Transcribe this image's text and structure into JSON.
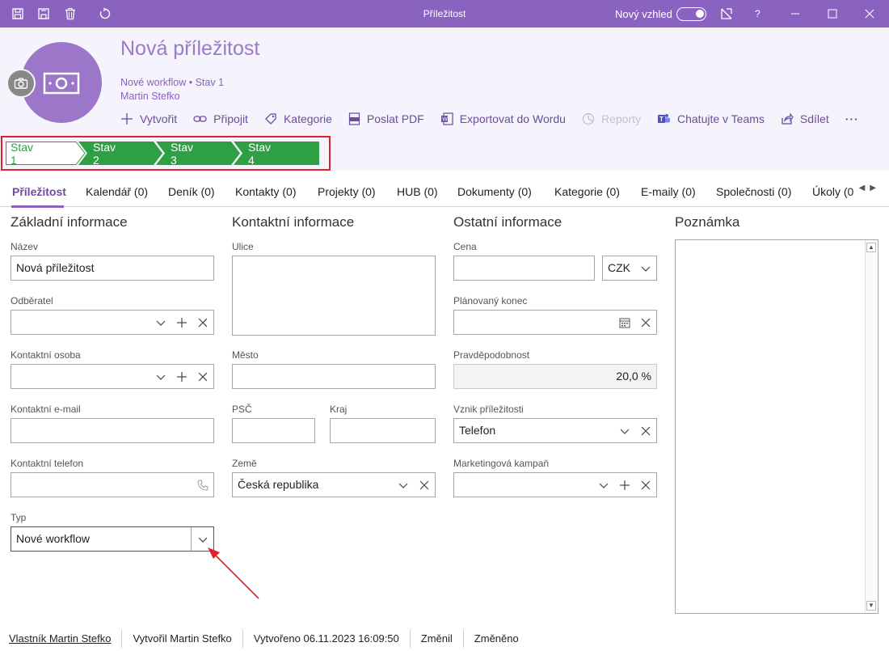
{
  "window": {
    "title": "Příležitost",
    "new_look_label": "Nový vzhled",
    "help_label": "?"
  },
  "header": {
    "title": "Nová příležitost",
    "subtitle": "Nové workflow • Stav 1",
    "owner": "Martin Stefko",
    "actions": [
      {
        "label": "Vytvořit",
        "icon": "plus-icon"
      },
      {
        "label": "Připojit",
        "icon": "link-icon"
      },
      {
        "label": "Kategorie",
        "icon": "tag-icon"
      },
      {
        "label": "Poslat PDF",
        "icon": "pdf-icon"
      },
      {
        "label": "Exportovat do Wordu",
        "icon": "word-icon"
      },
      {
        "label": "Reporty",
        "icon": "chart-icon",
        "disabled": true
      },
      {
        "label": "Chatujte v Teams",
        "icon": "teams-icon"
      },
      {
        "label": "Sdílet",
        "icon": "share-icon"
      }
    ],
    "more_label": "···"
  },
  "stages": [
    "Stav 1",
    "Stav 2",
    "Stav 3",
    "Stav 4"
  ],
  "tabs": [
    "Příležitost",
    "Kalendář (0)",
    "Deník (0)",
    "Kontakty (0)",
    "Projekty (0)",
    "HUB (0)",
    "Dokumenty (0)",
    "Kategorie (0)",
    "E-maily (0)",
    "Společnosti (0)",
    "Úkoly (0"
  ],
  "sections": {
    "basic": "Základní informace",
    "contact": "Kontaktní informace",
    "other": "Ostatní informace",
    "note": "Poznámka"
  },
  "fields": {
    "nazev": {
      "label": "Název",
      "value": "Nová příležitost"
    },
    "odberatel": {
      "label": "Odběratel",
      "value": ""
    },
    "kontaktni_osoba": {
      "label": "Kontaktní osoba",
      "value": ""
    },
    "kontaktni_email": {
      "label": "Kontaktní e-mail",
      "value": ""
    },
    "kontaktni_telefon": {
      "label": "Kontaktní telefon",
      "value": ""
    },
    "typ": {
      "label": "Typ",
      "value": "Nové workflow"
    },
    "ulice": {
      "label": "Ulice",
      "value": ""
    },
    "mesto": {
      "label": "Město",
      "value": ""
    },
    "psc": {
      "label": "PSČ",
      "value": ""
    },
    "kraj": {
      "label": "Kraj",
      "value": ""
    },
    "zeme": {
      "label": "Země",
      "value": "Česká republika"
    },
    "cena": {
      "label": "Cena",
      "value": "",
      "currency": "CZK"
    },
    "planovany_konec": {
      "label": "Plánovaný konec",
      "value": ""
    },
    "pravdepodobnost": {
      "label": "Pravděpodobnost",
      "value": "20,0 %"
    },
    "vznik": {
      "label": "Vznik příležitosti",
      "value": "Telefon"
    },
    "kampan": {
      "label": "Marketingová kampaň",
      "value": ""
    }
  },
  "footer": {
    "owner": "Vlastník Martin Stefko",
    "created_by": "Vytvořil Martin Stefko",
    "created_at": "Vytvořeno 06.11.2023 16:09:50",
    "modified_by": "Změnil",
    "modified_at": "Změněno"
  },
  "colors": {
    "brand": "#8a63c0",
    "stage_active": "#2ea043",
    "annotation": "#e0202a"
  }
}
